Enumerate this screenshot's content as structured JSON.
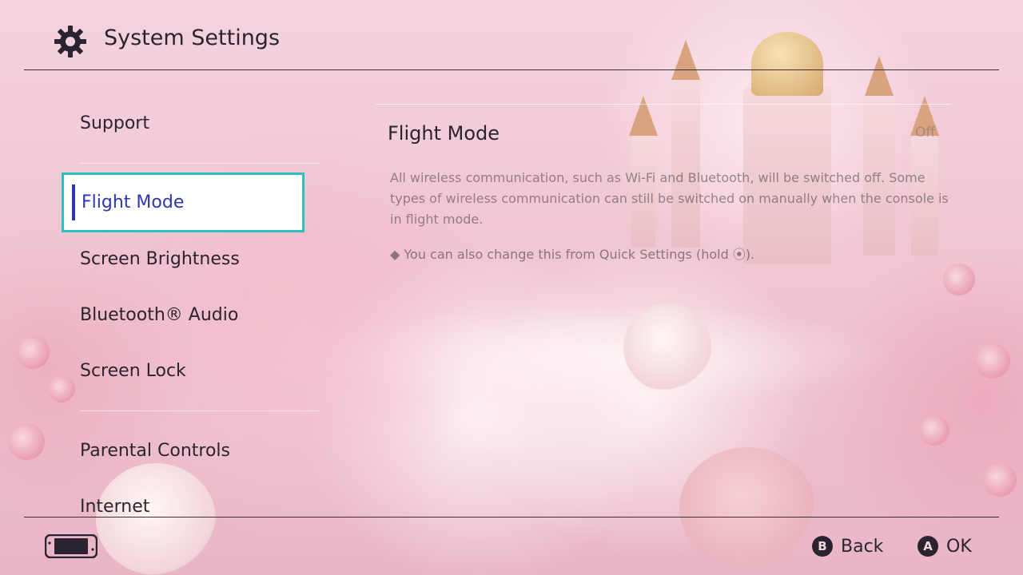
{
  "header": {
    "icon": "gear-icon",
    "title": "System Settings"
  },
  "sidebar": {
    "items": [
      {
        "label": "Support"
      },
      {
        "label": "Flight Mode",
        "selected": true
      },
      {
        "label": "Screen Brightness"
      },
      {
        "label": "Bluetooth® Audio"
      },
      {
        "label": "Screen Lock"
      },
      {
        "label": "Parental Controls"
      },
      {
        "label": "Internet"
      }
    ]
  },
  "main": {
    "setting_title": "Flight Mode",
    "setting_value": "Off",
    "description": "All wireless communication, such as Wi-Fi and Bluetooth, will be switched off. Some types of wireless communication can still be switched on manually when the console is in flight mode.",
    "note": "◆ You can also change this from Quick Settings (hold ⦿)."
  },
  "footer": {
    "console_icon": "console-icon",
    "back": {
      "button": "B",
      "label": "Back"
    },
    "ok": {
      "button": "A",
      "label": "OK"
    }
  },
  "colors": {
    "accent_border": "#2cc1bc",
    "selected_text": "#2c36b0"
  }
}
